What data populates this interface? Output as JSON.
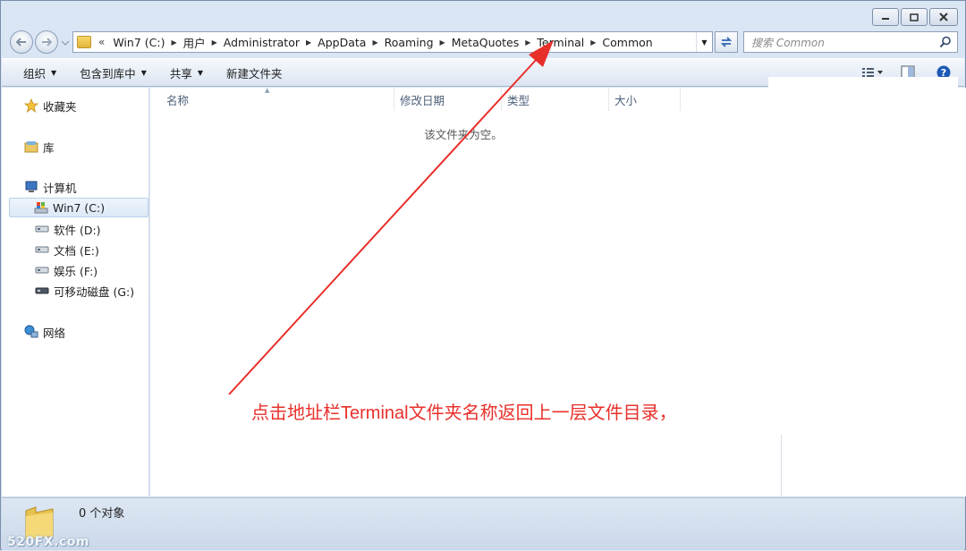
{
  "address": {
    "prefix": "«",
    "crumbs": [
      "Win7 (C:)",
      "用户",
      "Administrator",
      "AppData",
      "Roaming",
      "MetaQuotes",
      "Terminal",
      "Common"
    ]
  },
  "search": {
    "placeholder": "搜索 Common"
  },
  "toolbar": {
    "organize": "组织",
    "include_library": "包含到库中",
    "share": "共享",
    "new_folder": "新建文件夹"
  },
  "sidebar": {
    "favorites": "收藏夹",
    "libraries": "库",
    "computer": "计算机",
    "drives": [
      "Win7 (C:)",
      "软件 (D:)",
      "文档 (E:)",
      "娱乐 (F:)",
      "可移动磁盘 (G:)"
    ],
    "network": "网络"
  },
  "columns": [
    "名称",
    "修改日期",
    "类型",
    "大小"
  ],
  "empty_message": "该文件夹为空。",
  "status": {
    "count": "0 个对象",
    "watermark": "520FX.com"
  },
  "annotation": {
    "text": "点击地址栏Terminal文件夹名称返回上一层文件目录，",
    "color": "#e8302b"
  }
}
